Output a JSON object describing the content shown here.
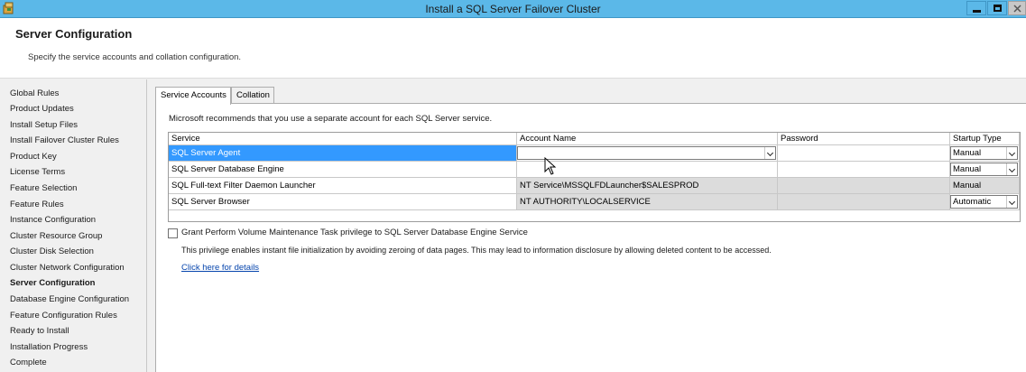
{
  "window": {
    "title": "Install a SQL Server Failover Cluster",
    "controls": [
      "minimize-icon",
      "maximize-icon",
      "close-icon"
    ]
  },
  "header": {
    "title": "Server Configuration",
    "description": "Specify the service accounts and collation configuration."
  },
  "nav": {
    "items": [
      "Global Rules",
      "Product Updates",
      "Install Setup Files",
      "Install Failover Cluster Rules",
      "Product Key",
      "License Terms",
      "Feature Selection",
      "Feature Rules",
      "Instance Configuration",
      "Cluster Resource Group",
      "Cluster Disk Selection",
      "Cluster Network Configuration",
      "Server Configuration",
      "Database Engine Configuration",
      "Feature Configuration Rules",
      "Ready to Install",
      "Installation Progress",
      "Complete"
    ],
    "active": "Server Configuration"
  },
  "tabs": [
    "Service Accounts",
    "Collation"
  ],
  "active_tab": "Service Accounts",
  "recommendation": "Microsoft recommends that you use a separate account for each SQL Server service.",
  "grid": {
    "columns": [
      "Service",
      "Account Name",
      "Password",
      "Startup Type"
    ],
    "rows": [
      {
        "service": "SQL Server Agent",
        "account": "",
        "password": "",
        "startup": "Manual",
        "selected": true
      },
      {
        "service": "SQL Server Database Engine",
        "account": "",
        "password": "",
        "startup": "Manual",
        "selected": false
      },
      {
        "service": "SQL Full-text Filter Daemon Launcher",
        "account": "NT Service\\MSSQLFDLauncher$SALESPROD",
        "password": "",
        "startup": "Manual",
        "selected": false
      },
      {
        "service": "SQL Server Browser",
        "account": "NT AUTHORITY\\LOCALSERVICE",
        "password": "",
        "startup": "Automatic",
        "selected": false
      }
    ]
  },
  "privilege": {
    "checkbox_label": "Grant Perform Volume Maintenance Task privilege to SQL Server Database Engine Service",
    "checked": false,
    "note": "This privilege enables instant file initialization by avoiding zeroing of data pages. This may lead to information disclosure by allowing deleted content to be accessed.",
    "link": "Click here for details"
  },
  "colors": {
    "titlebar": "#5bb8e8",
    "selection": "#3399ff",
    "link": "#0645ad",
    "readonly_cell": "#dcdcdc"
  }
}
